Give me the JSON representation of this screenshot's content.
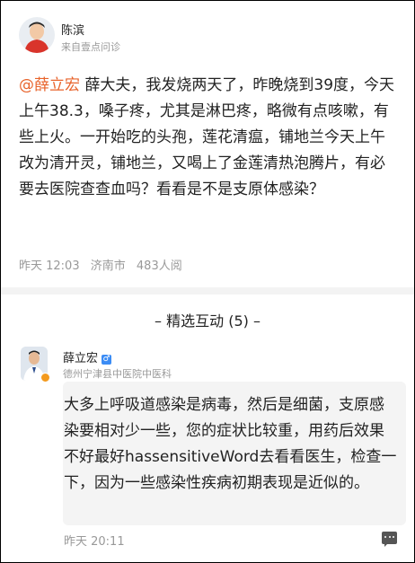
{
  "post": {
    "author": "陈滨",
    "source": "来自壹点问诊",
    "mention": "@薛立宏",
    "text": " 薛大夫，我发烧两天了，昨晚烧到39度，今天上午38.3，嗓子疼，尤其是淋巴疼，略微有点咳嗽，有些上火。一开始吃的头孢，莲花清瘟，铺地兰今天上午改为清开灵，铺地兰，又喝上了金莲清热泡腾片，有必要去医院查查血吗？看看是不是支原体感染？",
    "meta": {
      "time": "昨天 12:03",
      "location": "济南市",
      "views": "483人阅"
    }
  },
  "section": {
    "title": "– 精选互动 (5) –"
  },
  "reply": {
    "name": "薛立宏",
    "gender_icon": "male-icon",
    "gender_symbol": "♂",
    "org": "德州宁津县中医院中医科",
    "text": "大多上呼吸道感染是病毒，然后是细菌，支原感染要相对少一些，您的症状比较重，用药后效果不好最好hassensitiveWord去看看医生，检查一下，因为一些感染性疾病初期表现是近似的。",
    "time": "昨天 20:11"
  },
  "colors": {
    "mention": "#e8632b",
    "muted": "#999999",
    "text": "#222222",
    "divider": "#f3f3f3",
    "bubble": "#f4f4f4",
    "gender": "#3b8cf5"
  }
}
